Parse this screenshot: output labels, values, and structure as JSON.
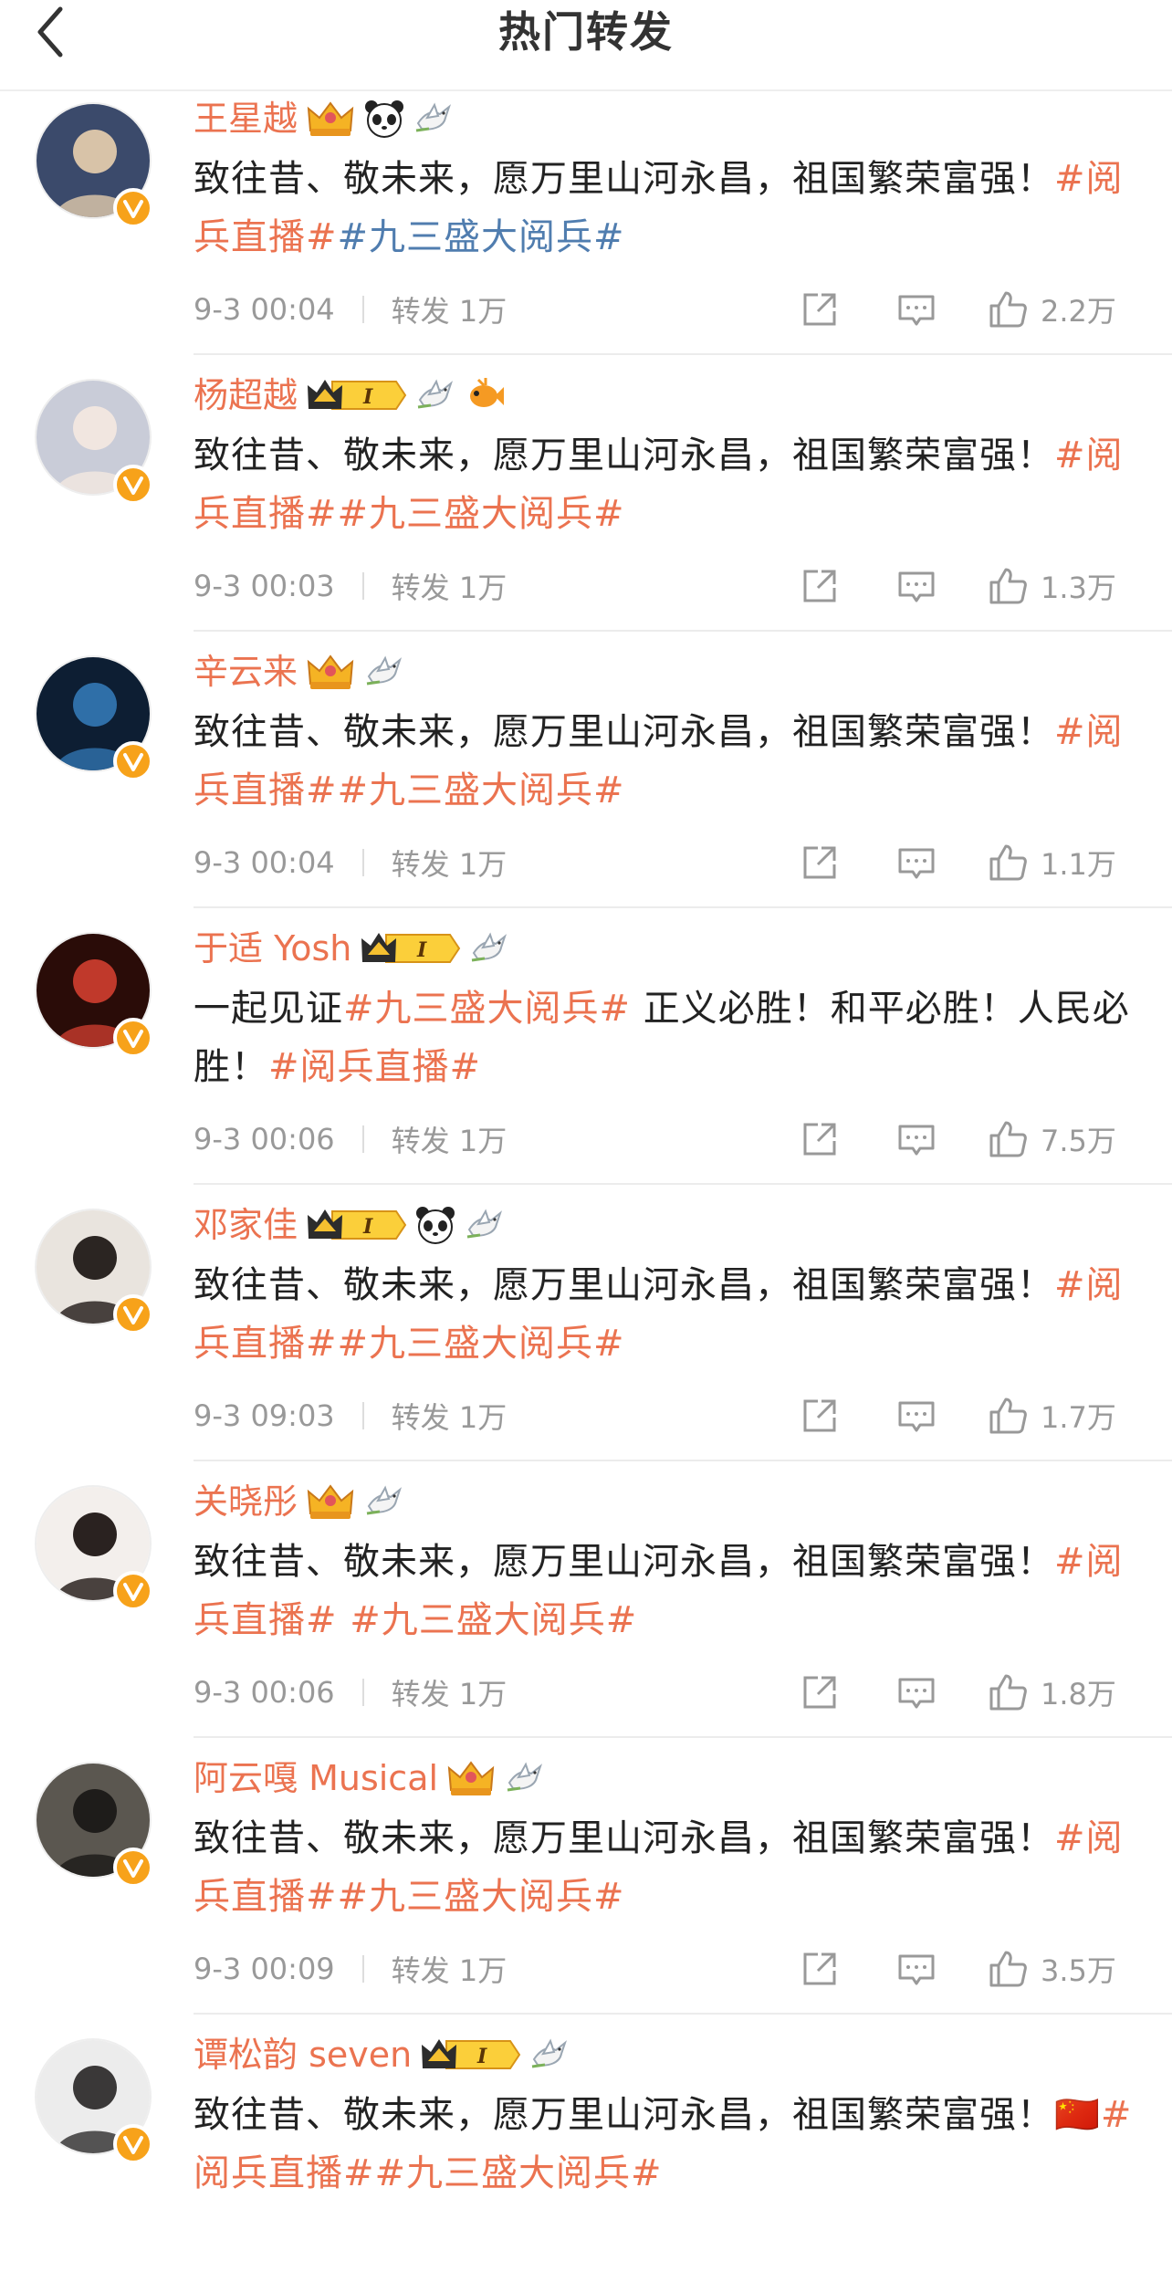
{
  "header": {
    "title": "热门转发"
  },
  "colors": {
    "accent": "#eb7350",
    "topic_blue": "#507daf",
    "meta_gray": "#999999",
    "badge_orange": "#f7a21a"
  },
  "comments": [
    {
      "name": "王星越",
      "badges": [
        "crown-icon",
        "panda-icon",
        "dove-icon"
      ],
      "segments": [
        {
          "t": "致往昔、敬未来，愿万里山河永昌，祖国繁荣富强！",
          "c": "plain"
        },
        {
          "t": "#阅兵直播#",
          "c": "tag"
        },
        {
          "t": "#九三盛大阅兵#",
          "c": "tag blue"
        }
      ],
      "time": "9-3 00:04",
      "repost": "转发 1万",
      "likes": "2.2万",
      "avatar_colors": [
        "#3b4a6b",
        "#d8c3a8"
      ]
    },
    {
      "name": "杨超越",
      "badges": [
        "crown-level-icon",
        "dove-icon",
        "fish-icon"
      ],
      "segments": [
        {
          "t": "致往昔、敬未来，愿万里山河永昌，祖国繁荣富强！",
          "c": "plain"
        },
        {
          "t": "#阅兵直播##九三盛大阅兵#",
          "c": "tag"
        }
      ],
      "time": "9-3 00:03",
      "repost": "转发 1万",
      "likes": "1.3万",
      "avatar_colors": [
        "#c9ccd8",
        "#f1e6e0"
      ]
    },
    {
      "name": "辛云来",
      "badges": [
        "crown-icon",
        "dove-icon"
      ],
      "segments": [
        {
          "t": "致往昔、敬未来，愿万里山河永昌，祖国繁荣富强！",
          "c": "plain"
        },
        {
          "t": "#阅兵直播##九三盛大阅兵#",
          "c": "tag"
        }
      ],
      "time": "9-3 00:04",
      "repost": "转发 1万",
      "likes": "1.1万",
      "avatar_colors": [
        "#0d1e33",
        "#2f6fa8"
      ]
    },
    {
      "name": "于适 Yosh",
      "badges": [
        "crown-level-icon",
        "dove-icon"
      ],
      "segments": [
        {
          "t": "一起见证",
          "c": "plain"
        },
        {
          "t": "#九三盛大阅兵#",
          "c": "tag"
        },
        {
          "t": " 正义必胜！和平必胜！人民必胜！",
          "c": "plain"
        },
        {
          "t": "#阅兵直播#",
          "c": "tag"
        }
      ],
      "time": "9-3 00:06",
      "repost": "转发 1万",
      "likes": "7.5万",
      "avatar_colors": [
        "#2a0c08",
        "#c0392b"
      ]
    },
    {
      "name": "邓家佳",
      "badges": [
        "crown-level-icon",
        "panda-icon",
        "dove-icon"
      ],
      "segments": [
        {
          "t": "致往昔、敬未来，愿万里山河永昌，祖国繁荣富强！",
          "c": "plain"
        },
        {
          "t": "#阅兵直播##九三盛大阅兵#",
          "c": "tag"
        }
      ],
      "time": "9-3 09:03",
      "repost": "转发 1万",
      "likes": "1.7万",
      "avatar_colors": [
        "#e9e4de",
        "#2b2522"
      ]
    },
    {
      "name": "关晓彤",
      "badges": [
        "crown-icon",
        "dove-icon"
      ],
      "segments": [
        {
          "t": "致往昔、敬未来，愿万里山河永昌，祖国繁荣富强！",
          "c": "plain"
        },
        {
          "t": "#阅兵直播# #九三盛大阅兵#",
          "c": "tag"
        }
      ],
      "time": "9-3 00:06",
      "repost": "转发 1万",
      "likes": "1.8万",
      "avatar_colors": [
        "#f3efec",
        "#2a2220"
      ]
    },
    {
      "name": "阿云嘎 Musical",
      "badges": [
        "crown-icon",
        "dove-icon"
      ],
      "segments": [
        {
          "t": "致往昔、敬未来，愿万里山河永昌，祖国繁荣富强！",
          "c": "plain"
        },
        {
          "t": "#阅兵直播##九三盛大阅兵#",
          "c": "tag"
        }
      ],
      "time": "9-3 00:09",
      "repost": "转发 1万",
      "likes": "3.5万",
      "avatar_colors": [
        "#5b5750",
        "#1e1c1a"
      ]
    },
    {
      "name": "谭松韵 seven",
      "badges": [
        "crown-level-icon",
        "dove-icon"
      ],
      "segments": [
        {
          "t": "致往昔、敬未来，愿万里山河永昌，祖国繁荣富强！",
          "c": "plain"
        },
        {
          "t": "🇨🇳",
          "c": "flag"
        },
        {
          "t": "#阅兵直播##九三盛大阅兵#",
          "c": "tag"
        }
      ],
      "time": "",
      "repost": "",
      "likes": "",
      "avatar_colors": [
        "#ececec",
        "#3a3838"
      ]
    }
  ]
}
